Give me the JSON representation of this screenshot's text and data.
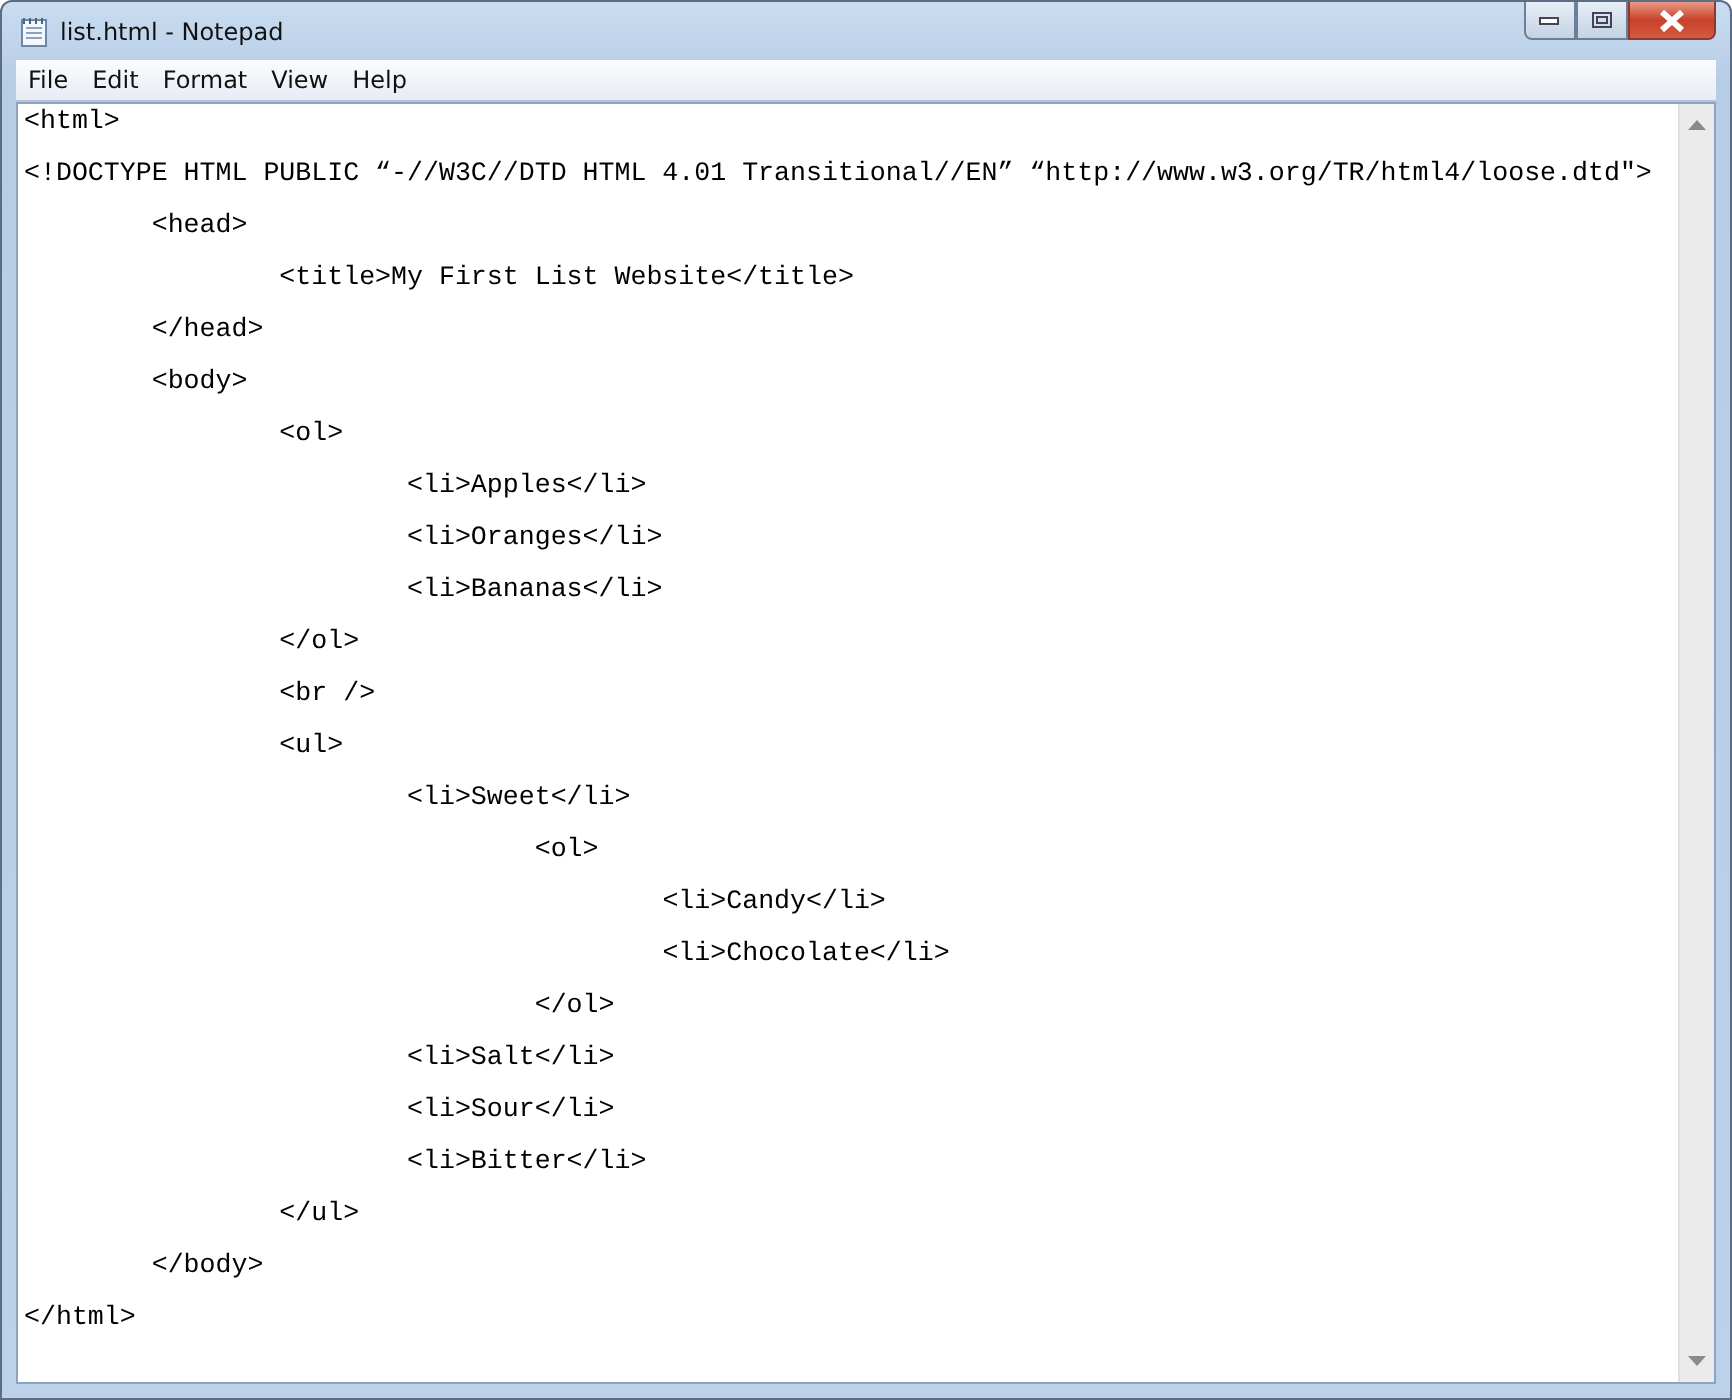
{
  "window": {
    "title": "list.html - Notepad"
  },
  "menu": [
    "File",
    "Edit",
    "Format",
    "View",
    "Help"
  ],
  "editor": {
    "lines": [
      "<html>",
      "<!DOCTYPE HTML PUBLIC “-//W3C//DTD HTML 4.01 Transitional//EN” “http://www.w3.org/TR/html4/loose.dtd\">",
      "\t<head>",
      "\t\t<title>My First List Website</title>",
      "\t</head>",
      "\t<body>",
      "\t\t<ol>",
      "\t\t\t<li>Apples</li>",
      "\t\t\t<li>Oranges</li>",
      "\t\t\t<li>Bananas</li>",
      "\t\t</ol>",
      "\t\t<br />",
      "\t\t<ul>",
      "\t\t\t<li>Sweet</li>",
      "\t\t\t\t<ol>",
      "\t\t\t\t\t<li>Candy</li>",
      "\t\t\t\t\t<li>Chocolate</li>",
      "\t\t\t\t</ol>",
      "\t\t\t<li>Salt</li>",
      "\t\t\t<li>Sour</li>",
      "\t\t\t<li>Bitter</li>",
      "\t\t</ul>",
      "\t</body>",
      "</html>"
    ]
  }
}
